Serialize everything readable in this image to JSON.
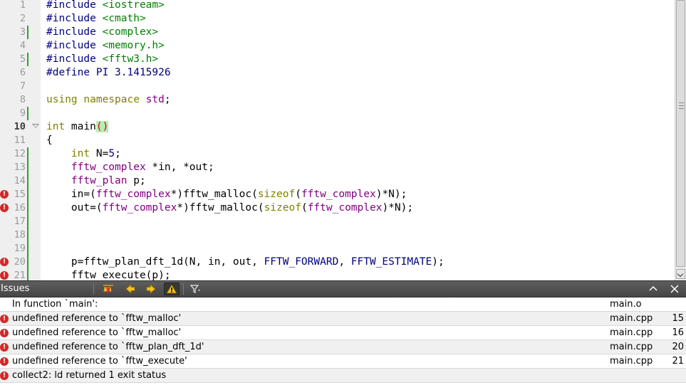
{
  "editor": {
    "current_line": 10,
    "lines": [
      {
        "n": "1",
        "changed": false,
        "error": false,
        "fold": false,
        "tokens": [
          {
            "c": "t-pp",
            "t": "#include "
          },
          {
            "c": "t-inc",
            "t": "<iostream>"
          }
        ]
      },
      {
        "n": "2",
        "changed": false,
        "error": false,
        "fold": false,
        "tokens": [
          {
            "c": "t-pp",
            "t": "#include "
          },
          {
            "c": "t-inc",
            "t": "<cmath>"
          }
        ]
      },
      {
        "n": "3",
        "changed": true,
        "error": false,
        "fold": false,
        "tokens": [
          {
            "c": "t-pp",
            "t": "#include "
          },
          {
            "c": "t-inc",
            "t": "<complex>"
          }
        ]
      },
      {
        "n": "4",
        "changed": false,
        "error": false,
        "fold": false,
        "tokens": [
          {
            "c": "t-pp",
            "t": "#include "
          },
          {
            "c": "t-inc",
            "t": "<memory.h>"
          }
        ]
      },
      {
        "n": "5",
        "changed": true,
        "error": false,
        "fold": false,
        "tokens": [
          {
            "c": "t-pp",
            "t": "#include "
          },
          {
            "c": "t-inc",
            "t": "<fftw3.h>"
          }
        ]
      },
      {
        "n": "6",
        "changed": false,
        "error": false,
        "fold": false,
        "tokens": [
          {
            "c": "t-pp",
            "t": "#define PI 3.1415926"
          }
        ]
      },
      {
        "n": "7",
        "changed": false,
        "error": false,
        "fold": false,
        "tokens": []
      },
      {
        "n": "8",
        "changed": false,
        "error": false,
        "fold": false,
        "tokens": [
          {
            "c": "t-kw",
            "t": "using"
          },
          {
            "c": "",
            "t": " "
          },
          {
            "c": "t-kw",
            "t": "namespace"
          },
          {
            "c": "",
            "t": " "
          },
          {
            "c": "t-type",
            "t": "std"
          },
          {
            "c": "",
            "t": ";"
          }
        ]
      },
      {
        "n": "9",
        "changed": true,
        "error": false,
        "fold": false,
        "tokens": []
      },
      {
        "n": "10",
        "changed": false,
        "error": false,
        "fold": true,
        "tokens": [
          {
            "c": "t-kw",
            "t": "int"
          },
          {
            "c": "",
            "t": " main"
          },
          {
            "c": "t-paren",
            "t": "()"
          }
        ]
      },
      {
        "n": "11",
        "changed": false,
        "error": false,
        "fold": false,
        "tokens": [
          {
            "c": "",
            "t": "{"
          }
        ]
      },
      {
        "n": "12",
        "changed": true,
        "error": false,
        "fold": false,
        "tokens": [
          {
            "c": "",
            "t": "    "
          },
          {
            "c": "t-kw",
            "t": "int"
          },
          {
            "c": "",
            "t": " N="
          },
          {
            "c": "t-num",
            "t": "5"
          },
          {
            "c": "",
            "t": ";"
          }
        ]
      },
      {
        "n": "13",
        "changed": true,
        "error": false,
        "fold": false,
        "tokens": [
          {
            "c": "",
            "t": "    "
          },
          {
            "c": "t-type",
            "t": "fftw_complex"
          },
          {
            "c": "",
            "t": " *in, *out;"
          }
        ]
      },
      {
        "n": "14",
        "changed": true,
        "error": false,
        "fold": false,
        "tokens": [
          {
            "c": "",
            "t": "    "
          },
          {
            "c": "t-type",
            "t": "fftw_plan"
          },
          {
            "c": "",
            "t": " p;"
          }
        ]
      },
      {
        "n": "15",
        "changed": true,
        "error": true,
        "fold": false,
        "tokens": [
          {
            "c": "",
            "t": "    in=("
          },
          {
            "c": "t-type",
            "t": "fftw_complex"
          },
          {
            "c": "",
            "t": "*)fftw_malloc("
          },
          {
            "c": "t-kw",
            "t": "sizeof"
          },
          {
            "c": "",
            "t": "("
          },
          {
            "c": "t-type",
            "t": "fftw_complex"
          },
          {
            "c": "",
            "t": ")*N);"
          }
        ]
      },
      {
        "n": "16",
        "changed": true,
        "error": true,
        "fold": false,
        "tokens": [
          {
            "c": "",
            "t": "    out=("
          },
          {
            "c": "t-type",
            "t": "fftw_complex"
          },
          {
            "c": "",
            "t": "*)fftw_malloc("
          },
          {
            "c": "t-kw",
            "t": "sizeof"
          },
          {
            "c": "",
            "t": "("
          },
          {
            "c": "t-type",
            "t": "fftw_complex"
          },
          {
            "c": "",
            "t": ")*N);"
          }
        ]
      },
      {
        "n": "17",
        "changed": true,
        "error": false,
        "fold": false,
        "tokens": []
      },
      {
        "n": "18",
        "changed": true,
        "error": false,
        "fold": false,
        "tokens": []
      },
      {
        "n": "19",
        "changed": true,
        "error": false,
        "fold": false,
        "tokens": []
      },
      {
        "n": "20",
        "changed": true,
        "error": true,
        "fold": false,
        "tokens": [
          {
            "c": "",
            "t": "    p=fftw_plan_dft_1d(N, in, out, "
          },
          {
            "c": "t-enum",
            "t": "FFTW_FORWARD"
          },
          {
            "c": "",
            "t": ", "
          },
          {
            "c": "t-enum",
            "t": "FFTW_ESTIMATE"
          },
          {
            "c": "",
            "t": ");"
          }
        ]
      },
      {
        "n": "21",
        "changed": true,
        "error": true,
        "fold": false,
        "tokens": [
          {
            "c": "",
            "t": "    fftw_execute(p);"
          }
        ]
      }
    ]
  },
  "issues": {
    "title": "Issues",
    "toolbar": {
      "clean": "broom-icon",
      "prev": "arrow-left-icon",
      "next": "arrow-right-icon",
      "warnings": "warning-icon",
      "filter": "filter-icon",
      "maximize": "chevron-up-icon",
      "close": "close-icon"
    },
    "rows": [
      {
        "icon": false,
        "message": "In function `main':",
        "file": "main.o",
        "line": ""
      },
      {
        "icon": true,
        "message": "undefined reference to `fftw_malloc'",
        "file": "main.cpp",
        "line": "15"
      },
      {
        "icon": true,
        "message": "undefined reference to `fftw_malloc'",
        "file": "main.cpp",
        "line": "16"
      },
      {
        "icon": true,
        "message": "undefined reference to `fftw_plan_dft_1d'",
        "file": "main.cpp",
        "line": "20"
      },
      {
        "icon": true,
        "message": "undefined reference to `fftw_execute'",
        "file": "main.cpp",
        "line": "21"
      },
      {
        "icon": true,
        "message": "collect2: ld returned 1 exit status",
        "file": "",
        "line": ""
      }
    ]
  },
  "colors": {
    "error": "#d42828",
    "change_marker": "#2aa52a",
    "preprocessor": "#000080",
    "include_path": "#008000",
    "keyword": "#808000",
    "type": "#800080"
  }
}
